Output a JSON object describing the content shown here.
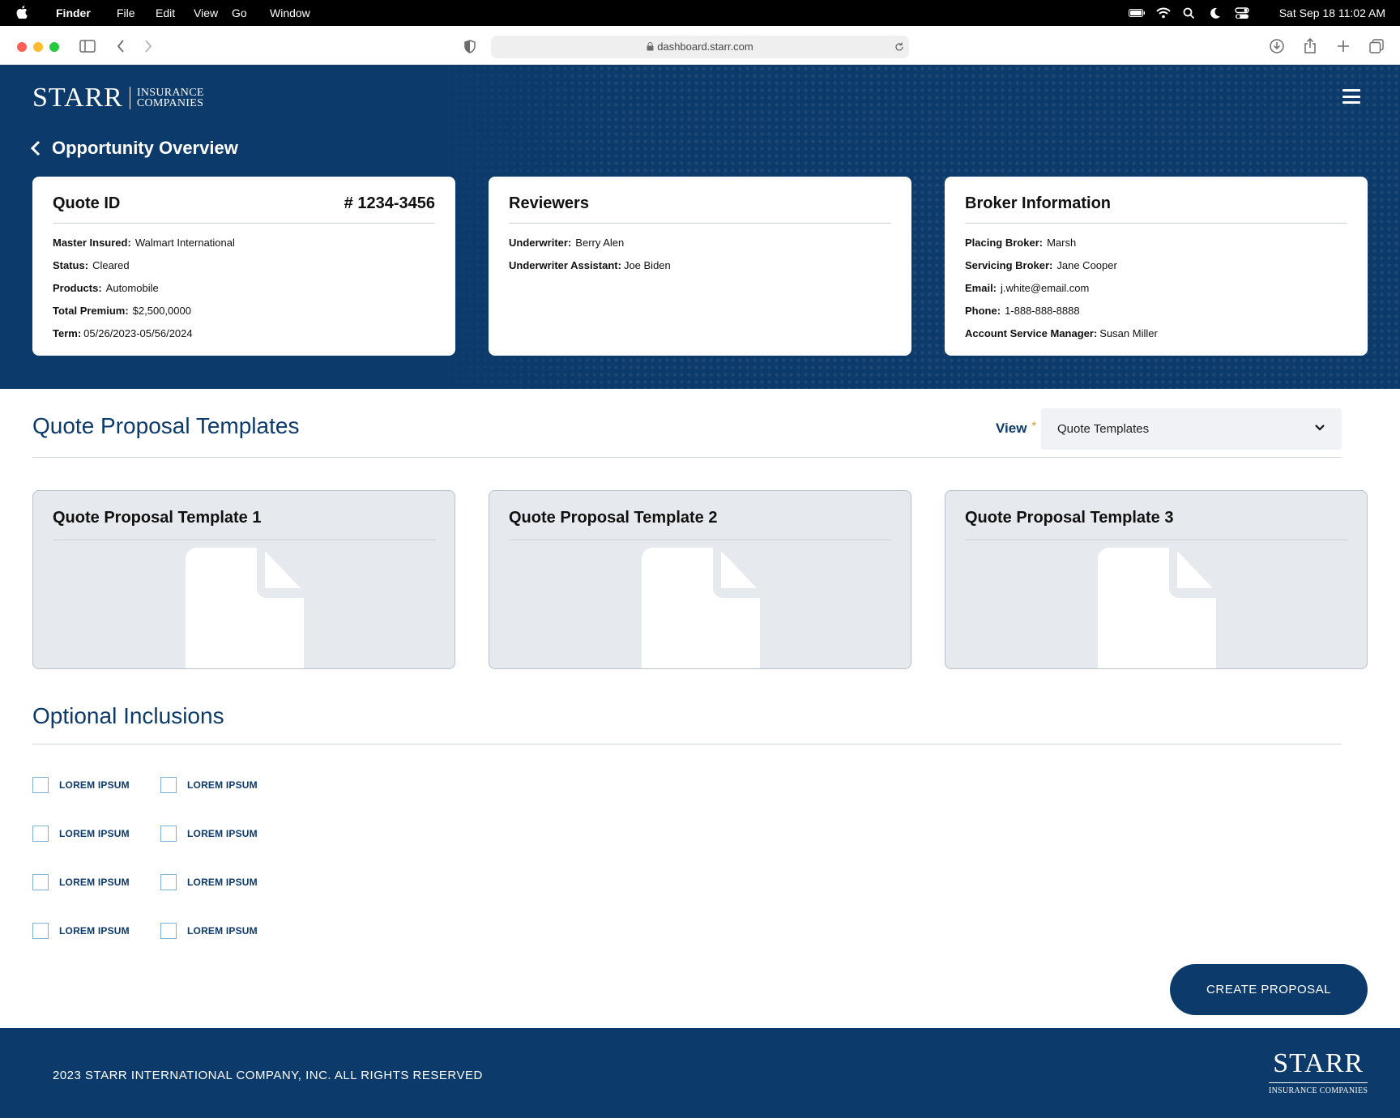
{
  "menubar": {
    "apple_icon": "apple-icon",
    "app": "Finder",
    "items": [
      "File",
      "Edit",
      "View",
      "Go",
      "Window"
    ],
    "clock": "Sat Sep 18  11:02 AM"
  },
  "browser": {
    "url": "dashboard.starr.com"
  },
  "brand": {
    "wordmark": "STARR",
    "sub_line1": "INSURANCE",
    "sub_line2": "COMPANIES",
    "footer_sub": "INSURANCE COMPANIES"
  },
  "header": {
    "page_title": "Opportunity Overview"
  },
  "quote_card": {
    "title": "Quote ID",
    "number": "# 1234-3456",
    "rows": [
      {
        "label": "Master Insured:",
        "value": "Walmart International"
      },
      {
        "label": "Status:",
        "value": "Cleared"
      },
      {
        "label": "Products:",
        "value": "Automobile"
      },
      {
        "label": "Total Premium:",
        "value": "$2,500,0000"
      },
      {
        "label": "Term:",
        "value": "05/26/2023-05/56/2024"
      }
    ]
  },
  "reviewers_card": {
    "title": "Reviewers",
    "rows": [
      {
        "label": "Underwriter:",
        "value": "Berry Alen"
      },
      {
        "label": "Underwriter Assistant:",
        "value": "Joe Biden"
      }
    ]
  },
  "broker_card": {
    "title": "Broker Information",
    "rows": [
      {
        "label": "Placing Broker:",
        "value": "Marsh"
      },
      {
        "label": "Servicing Broker:",
        "value": "Jane Cooper"
      },
      {
        "label": "Email:",
        "value": "j.white@email.com"
      },
      {
        "label": "Phone:",
        "value": "1-888-888-8888"
      },
      {
        "label": "Account Service Manager:",
        "value": "Susan Miller"
      }
    ]
  },
  "templates": {
    "section_title": "Quote Proposal Templates",
    "view_label": "View",
    "required_mark": "*",
    "view_selected": "Quote Templates",
    "cards": [
      {
        "title": "Quote Proposal Template 1"
      },
      {
        "title": "Quote Proposal Template 2"
      },
      {
        "title": "Quote Proposal Template 3"
      }
    ]
  },
  "inclusions": {
    "section_title": "Optional Inclusions",
    "items": [
      "LOREM IPSUM",
      "LOREM IPSUM",
      "LOREM IPSUM",
      "LOREM IPSUM",
      "LOREM IPSUM",
      "LOREM IPSUM",
      "LOREM IPSUM",
      "LOREM IPSUM"
    ]
  },
  "actions": {
    "create_label": "CREATE PROPOSAL"
  },
  "footer": {
    "copyright": "2023 STARR INTERNATIONAL COMPANY, INC. ALL RIGHTS RESERVED"
  },
  "colors": {
    "brand_navy": "#0c3a6b",
    "required_orange": "#e38b2c",
    "checkbox_border": "#7fb0d6"
  }
}
